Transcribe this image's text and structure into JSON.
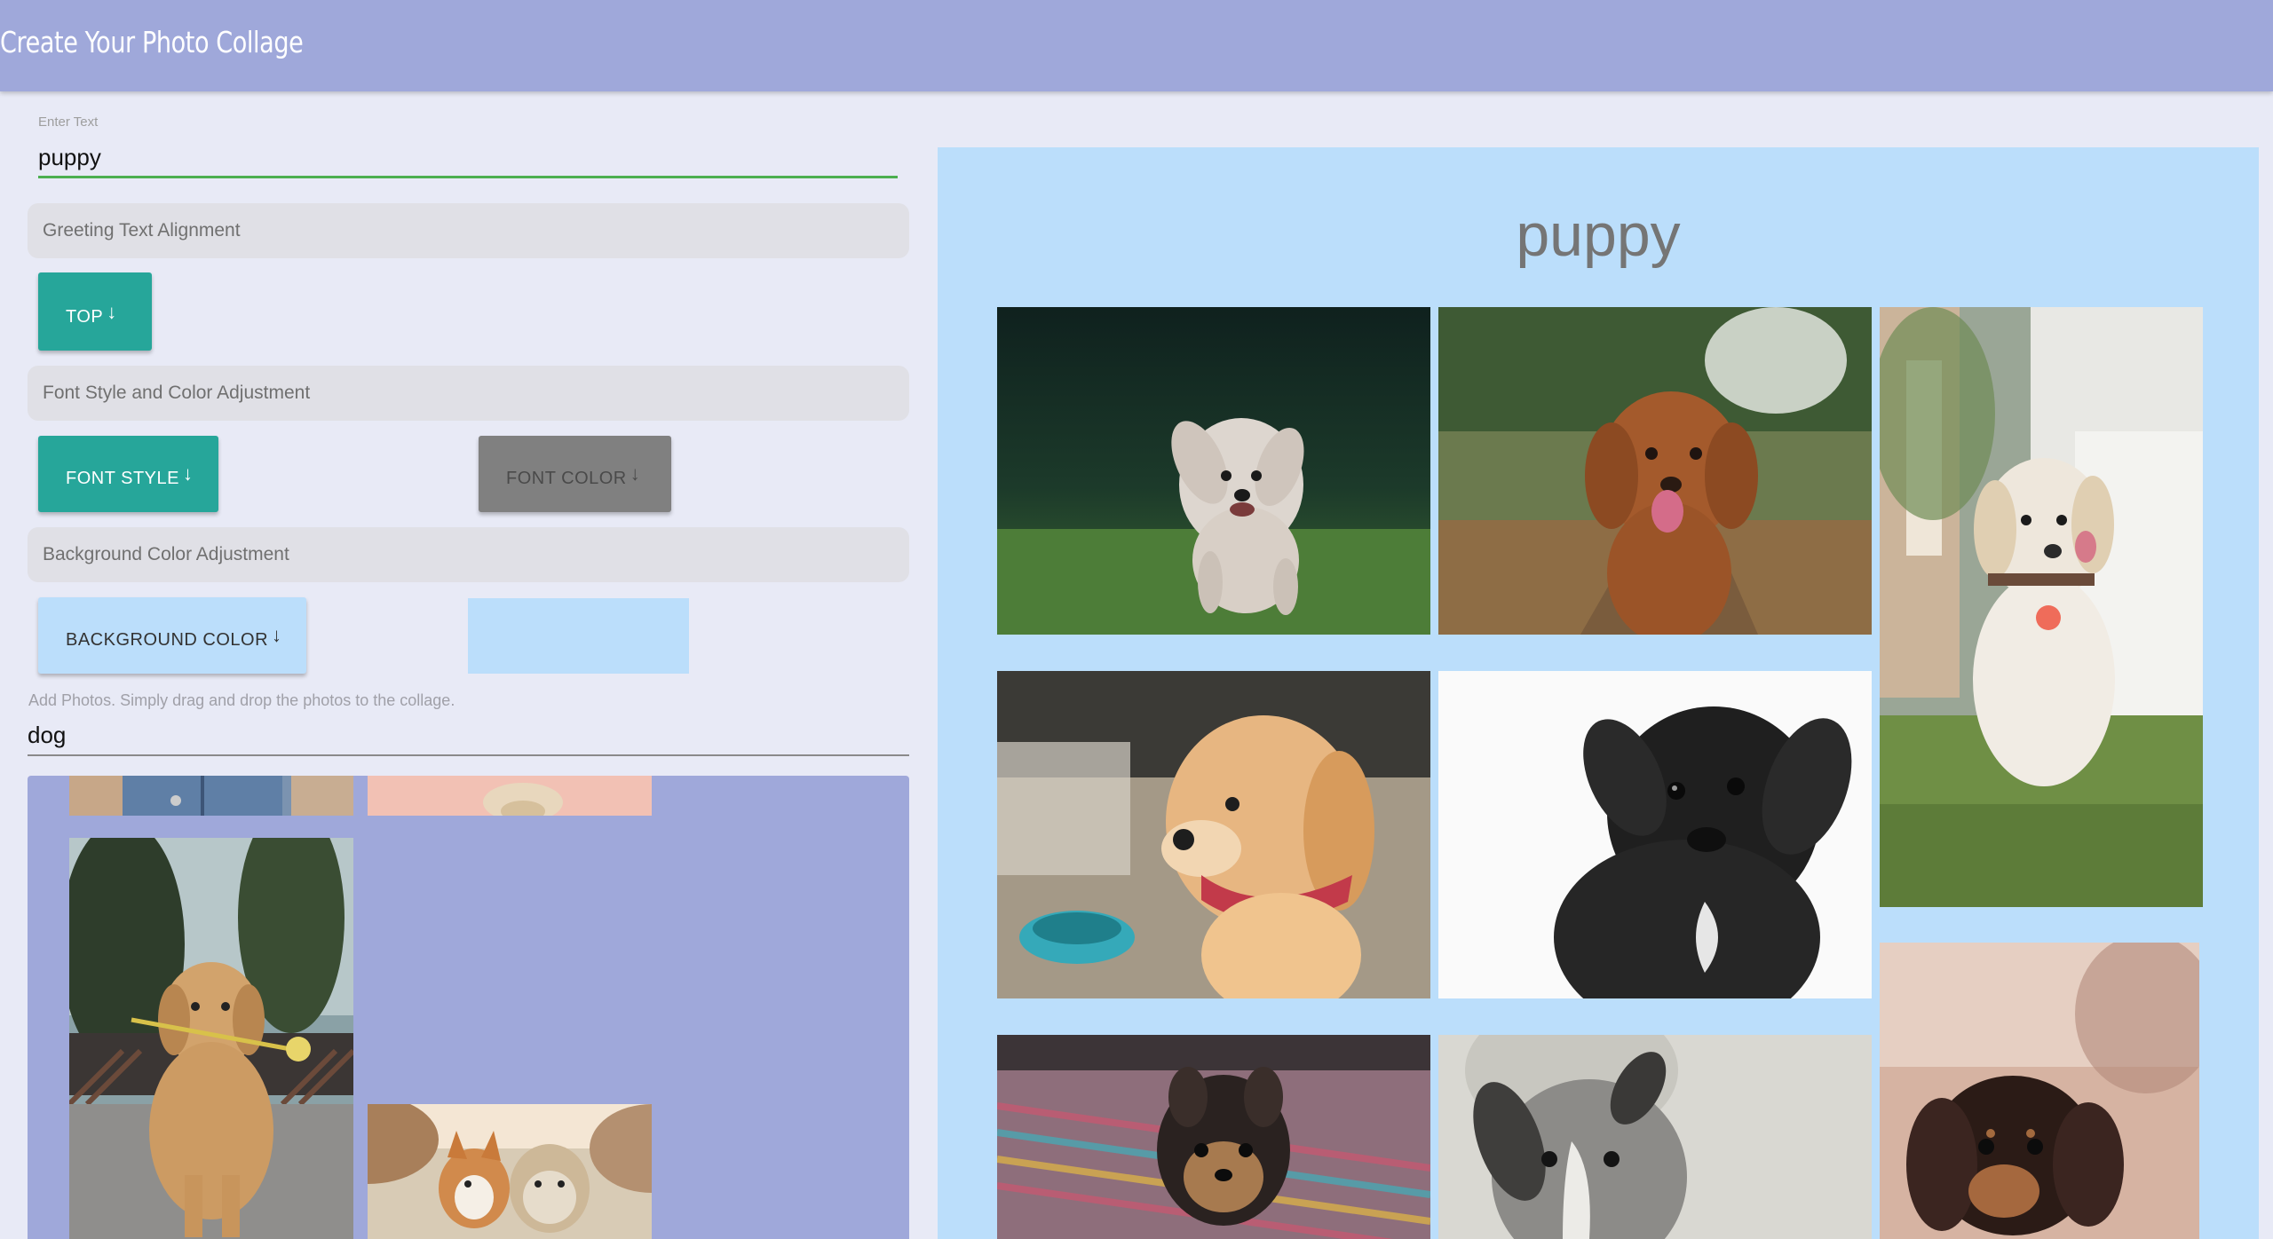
{
  "app": {
    "title": "Create Your Photo Collage"
  },
  "text_field": {
    "label": "Enter Text",
    "value": "puppy"
  },
  "sections": {
    "alignment": "Greeting Text Alignment",
    "font": "Font Style and Color Adjustment",
    "background": "Background Color Adjustment"
  },
  "buttons": {
    "top": "TOP",
    "font_style": "FONT STYLE",
    "font_color": "FONT COLOR",
    "background_color": "BACKGROUND COLOR",
    "arrow_glyph": "↓"
  },
  "colors": {
    "appbar": "#9fa8da",
    "page_bg": "#e8eaf6",
    "teal": "#26a69a",
    "font_color_swatch": "#808080",
    "background_color": "#bbdefb",
    "input_focus": "#4caf50"
  },
  "photos_panel": {
    "hint": "Add Photos. Simply drag and drop the photos to the collage.",
    "search_value": "dog",
    "thumbnails": [
      "denim-dog-thumbnail",
      "pink-dog-thumbnail",
      "golden-retriever-flower-thumbnail",
      "corgi-and-terrier-thumbnail"
    ]
  },
  "collage": {
    "title": "puppy",
    "photos": [
      "white-poodle-running",
      "brown-dog-field",
      "labrador-puppy-grass",
      "golden-puppy-red-collar",
      "black-puppy",
      "yorkie-puppy-rug",
      "gray-whippet-puppy",
      "dachshund-puppy"
    ]
  }
}
